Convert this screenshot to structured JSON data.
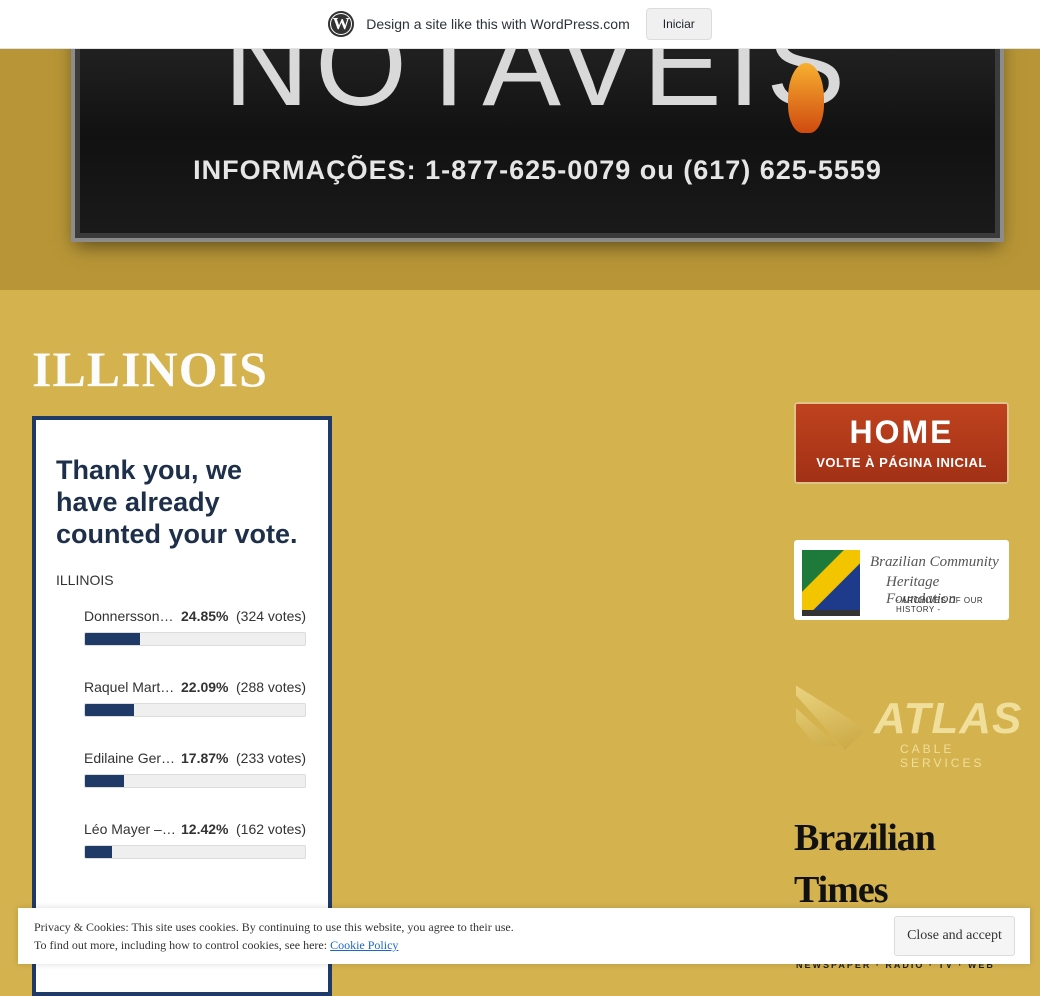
{
  "wpbar": {
    "message": "Design a site like this with WordPress.com",
    "button_label": "Iniciar",
    "logo_glyph": "W"
  },
  "banner": {
    "sign_title": "NOTAVEIS",
    "sign_info": "INFORMAÇÕES: 1-877-625-0079 ou (617) 625-5559"
  },
  "page": {
    "title": "ILLINOIS"
  },
  "poll": {
    "heading": "Thank you, we have already counted your vote.",
    "question": "ILLINOIS",
    "items": [
      {
        "name": "Donnersson…",
        "percent": "24.85%",
        "votes": "(324 votes)",
        "fill_percent": 24.85
      },
      {
        "name": "Raquel Mart…",
        "percent": "22.09%",
        "votes": "(288 votes)",
        "fill_percent": 22.09
      },
      {
        "name": "Edilaine Ger…",
        "percent": "17.87%",
        "votes": "(233 votes)",
        "fill_percent": 17.87
      },
      {
        "name": "Léo Mayer –…",
        "percent": "12.42%",
        "votes": "(162 votes)",
        "fill_percent": 12.42
      }
    ],
    "accent_color": "#1f3a66"
  },
  "sidebar": {
    "home_title": "HOME",
    "home_subtitle": "VOLTE À PÁGINA INICIAL",
    "bchf_line1": "Brazilian Community",
    "bchf_line2": "Heritage Foundation",
    "bchf_line3": "- ARCHIVES OF OUR HISTORY -",
    "atlas_word": "ATLAS",
    "atlas_sub": "CABLE SERVICES",
    "btimes_word": "Brazilian Times",
    "btimes_sub": "NEWSPAPER · RADIO · TV · WEB"
  },
  "cookie": {
    "line1": "Privacy & Cookies: This site uses cookies. By continuing to use this website, you agree to their use.",
    "line2": "To find out more, including how to control cookies, see here:",
    "link_label": "Cookie Policy",
    "button_label": "Close and accept"
  }
}
